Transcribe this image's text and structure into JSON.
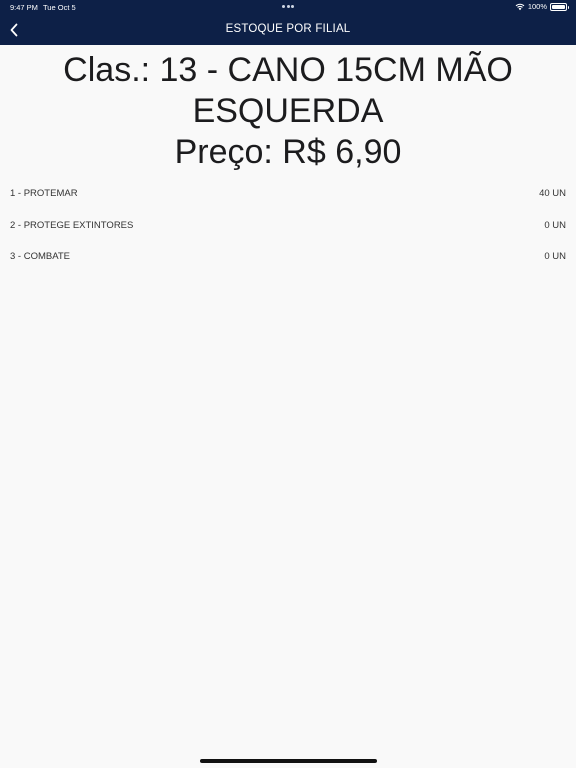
{
  "status_bar": {
    "time": "9:47 PM",
    "date": "Tue Oct 5",
    "battery": "100%",
    "icons": [
      "wifi-icon",
      "battery-icon"
    ]
  },
  "nav": {
    "title": "ESTOQUE POR FILIAL",
    "back_icon": "chevron-left-icon"
  },
  "product": {
    "line1": "Clas.: 13 - CANO 15CM MÃO",
    "line2": "ESQUERDA",
    "line3": "Preço: R$ 6,90"
  },
  "stock": [
    {
      "branch": "1 - PROTEMAR",
      "qty": "40 UN"
    },
    {
      "branch": "2 - PROTEGE EXTINTORES",
      "qty": "0 UN"
    },
    {
      "branch": "3 - COMBATE",
      "qty": "0 UN"
    }
  ],
  "colors": {
    "header_bg": "#0d2047",
    "page_bg": "#f9f9f9",
    "text": "#1c1c1e"
  }
}
